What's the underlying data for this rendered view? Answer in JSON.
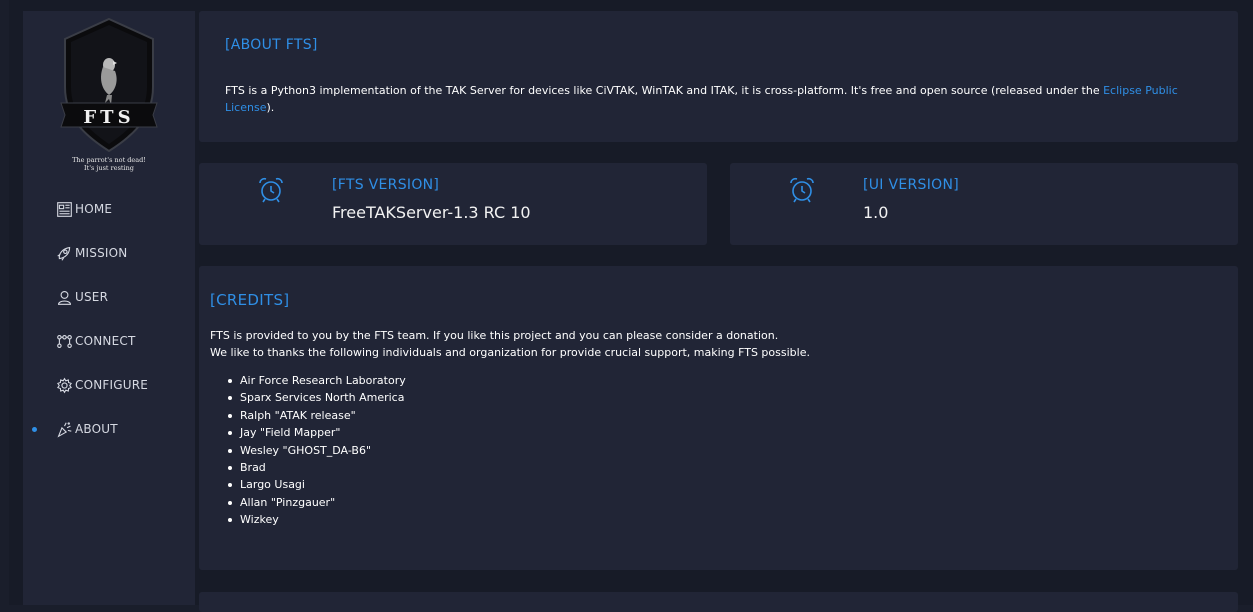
{
  "brand": {
    "logo_text": "FTS",
    "tagline_line1": "The parrot's not dead!",
    "tagline_line2": "It's just resting"
  },
  "nav": {
    "items": [
      {
        "label": "HOME",
        "icon": "home-icon",
        "active": false
      },
      {
        "label": "MISSION",
        "icon": "mission-icon",
        "active": false
      },
      {
        "label": "USER",
        "icon": "user-icon",
        "active": false
      },
      {
        "label": "CONNECT",
        "icon": "connect-icon",
        "active": false
      },
      {
        "label": "CONFIGURE",
        "icon": "gear-icon",
        "active": false
      },
      {
        "label": "ABOUT",
        "icon": "about-icon",
        "active": true
      }
    ]
  },
  "about": {
    "title": "[ABOUT FTS]",
    "text_before_link": "FTS is a Python3 implementation of the TAK Server for devices like CiVTAK, WinTAK and ITAK, it is cross-platform. It's free and open source (released under the ",
    "link_text": "Eclipse Public License",
    "text_after_link": ")."
  },
  "versions": {
    "fts": {
      "title": "[FTS VERSION]",
      "value": "FreeTAKServer-1.3 RC 10",
      "icon": "alarm-clock-icon"
    },
    "ui": {
      "title": "[UI VERSION]",
      "value": "1.0",
      "icon": "alarm-clock-icon"
    }
  },
  "credits": {
    "title": "[CREDITS]",
    "intro_line1": "FTS is provided to you by the FTS team. If you like this project and you can please consider a donation.",
    "intro_line2": "We like to thanks the following individuals and organization for provide crucial support, making FTS possible.",
    "names": [
      "Air Force Research Laboratory",
      "Sparx Services North America",
      "Ralph \"ATAK release\"",
      "Jay \"Field Mapper\"",
      "Wesley \"GHOST_DA-B6\"",
      "Brad",
      "Largo Usagi",
      "Allan \"Pinzgauer\"",
      "Wizkey"
    ]
  },
  "colors": {
    "accent": "#2f8fe6",
    "background": "#1a1e2b",
    "panel": "#212536"
  }
}
